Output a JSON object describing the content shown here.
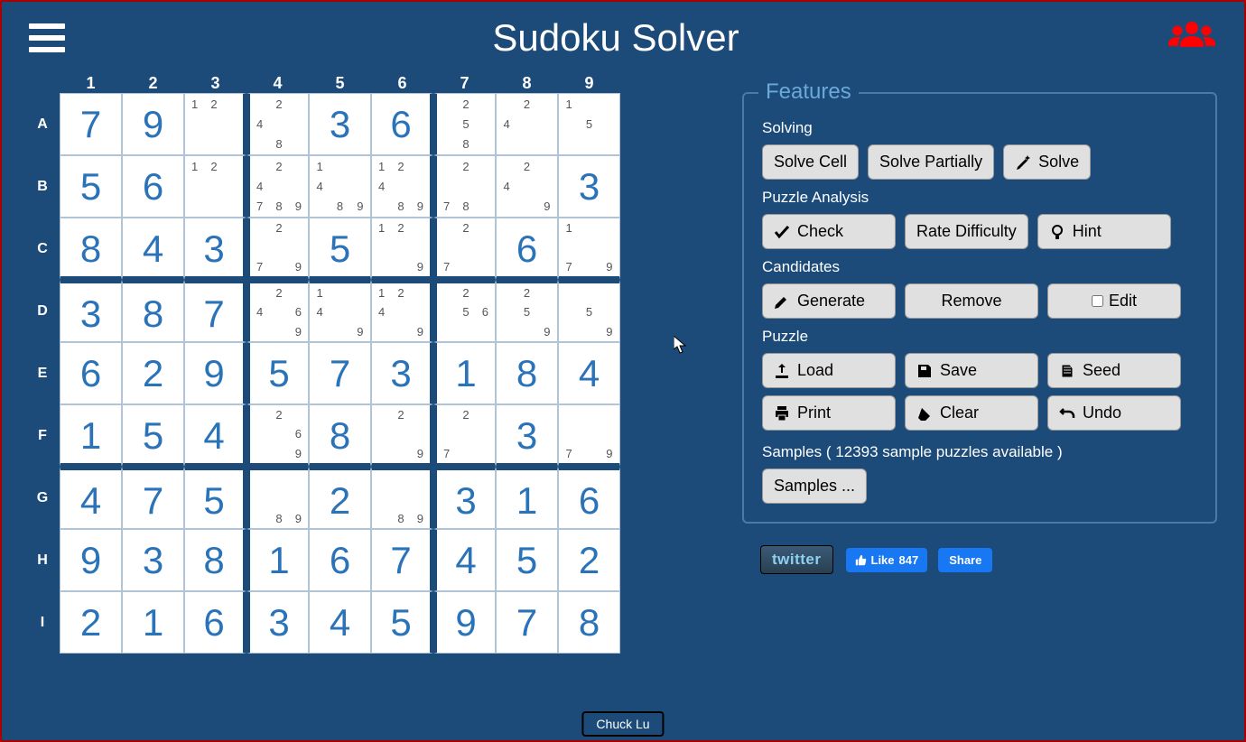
{
  "title": "Sudoku Solver",
  "cols": [
    "1",
    "2",
    "3",
    "4",
    "5",
    "6",
    "7",
    "8",
    "9"
  ],
  "rows": [
    "A",
    "B",
    "C",
    "D",
    "E",
    "F",
    "G",
    "H",
    "I"
  ],
  "grid": [
    [
      {
        "v": "7"
      },
      {
        "v": "9"
      },
      {
        "c": [
          1,
          2
        ]
      },
      {
        "c": [
          2,
          4,
          8
        ]
      },
      {
        "v": "3"
      },
      {
        "v": "6"
      },
      {
        "c": [
          2,
          5,
          8
        ]
      },
      {
        "c": [
          2,
          4
        ]
      },
      {
        "c": [
          1,
          5
        ]
      }
    ],
    [
      {
        "v": "5"
      },
      {
        "v": "6"
      },
      {
        "c": [
          1,
          2
        ]
      },
      {
        "c": [
          2,
          4,
          7,
          8,
          9
        ]
      },
      {
        "c": [
          1,
          4,
          8,
          9
        ]
      },
      {
        "c": [
          1,
          2,
          4,
          8,
          9
        ]
      },
      {
        "c": [
          2,
          7,
          8
        ]
      },
      {
        "c": [
          2,
          4,
          9
        ]
      },
      {
        "v": "3"
      }
    ],
    [
      {
        "v": "8"
      },
      {
        "v": "4"
      },
      {
        "v": "3"
      },
      {
        "c": [
          2,
          7,
          9
        ]
      },
      {
        "v": "5"
      },
      {
        "c": [
          1,
          2,
          9
        ]
      },
      {
        "c": [
          2,
          7
        ]
      },
      {
        "v": "6"
      },
      {
        "c": [
          1,
          7,
          9
        ]
      }
    ],
    [
      {
        "v": "3"
      },
      {
        "v": "8"
      },
      {
        "v": "7"
      },
      {
        "c": [
          2,
          4,
          6,
          9
        ]
      },
      {
        "c": [
          1,
          4,
          9
        ]
      },
      {
        "c": [
          1,
          2,
          4,
          9
        ]
      },
      {
        "c": [
          2,
          5,
          6
        ]
      },
      {
        "c": [
          2,
          5,
          9
        ]
      },
      {
        "c": [
          5,
          9
        ]
      }
    ],
    [
      {
        "v": "6"
      },
      {
        "v": "2"
      },
      {
        "v": "9"
      },
      {
        "v": "5"
      },
      {
        "v": "7"
      },
      {
        "v": "3"
      },
      {
        "v": "1"
      },
      {
        "v": "8"
      },
      {
        "v": "4"
      }
    ],
    [
      {
        "v": "1"
      },
      {
        "v": "5"
      },
      {
        "v": "4"
      },
      {
        "c": [
          2,
          6,
          9
        ]
      },
      {
        "v": "8"
      },
      {
        "c": [
          2,
          9
        ]
      },
      {
        "c": [
          2,
          7
        ]
      },
      {
        "v": "3"
      },
      {
        "c": [
          7,
          9
        ]
      }
    ],
    [
      {
        "v": "4"
      },
      {
        "v": "7"
      },
      {
        "v": "5"
      },
      {
        "c": [
          8,
          9
        ]
      },
      {
        "v": "2"
      },
      {
        "c": [
          8,
          9
        ]
      },
      {
        "v": "3"
      },
      {
        "v": "1"
      },
      {
        "v": "6"
      }
    ],
    [
      {
        "v": "9"
      },
      {
        "v": "3"
      },
      {
        "v": "8"
      },
      {
        "v": "1"
      },
      {
        "v": "6"
      },
      {
        "v": "7"
      },
      {
        "v": "4"
      },
      {
        "v": "5"
      },
      {
        "v": "2"
      }
    ],
    [
      {
        "v": "2"
      },
      {
        "v": "1"
      },
      {
        "v": "6"
      },
      {
        "v": "3"
      },
      {
        "v": "4"
      },
      {
        "v": "5"
      },
      {
        "v": "9"
      },
      {
        "v": "7"
      },
      {
        "v": "8"
      }
    ]
  ],
  "features": {
    "legend": "Features",
    "solving_label": "Solving",
    "solve_cell": "Solve Cell",
    "solve_partially": "Solve Partially",
    "solve": "Solve",
    "analysis_label": "Puzzle Analysis",
    "check": "Check",
    "rate": "Rate Difficulty",
    "hint": "Hint",
    "candidates_label": "Candidates",
    "generate": "Generate",
    "remove": "Remove",
    "edit": "Edit",
    "puzzle_label": "Puzzle",
    "load": "Load",
    "save": "Save",
    "seed": "Seed",
    "print": "Print",
    "clear": "Clear",
    "undo": "Undo",
    "samples_text": "Samples ( 12393 sample puzzles available )",
    "samples_btn": "Samples ..."
  },
  "social": {
    "twitter": "twitter",
    "like": "Like",
    "like_count": "847",
    "share": "Share"
  },
  "footer_name": "Chuck Lu"
}
